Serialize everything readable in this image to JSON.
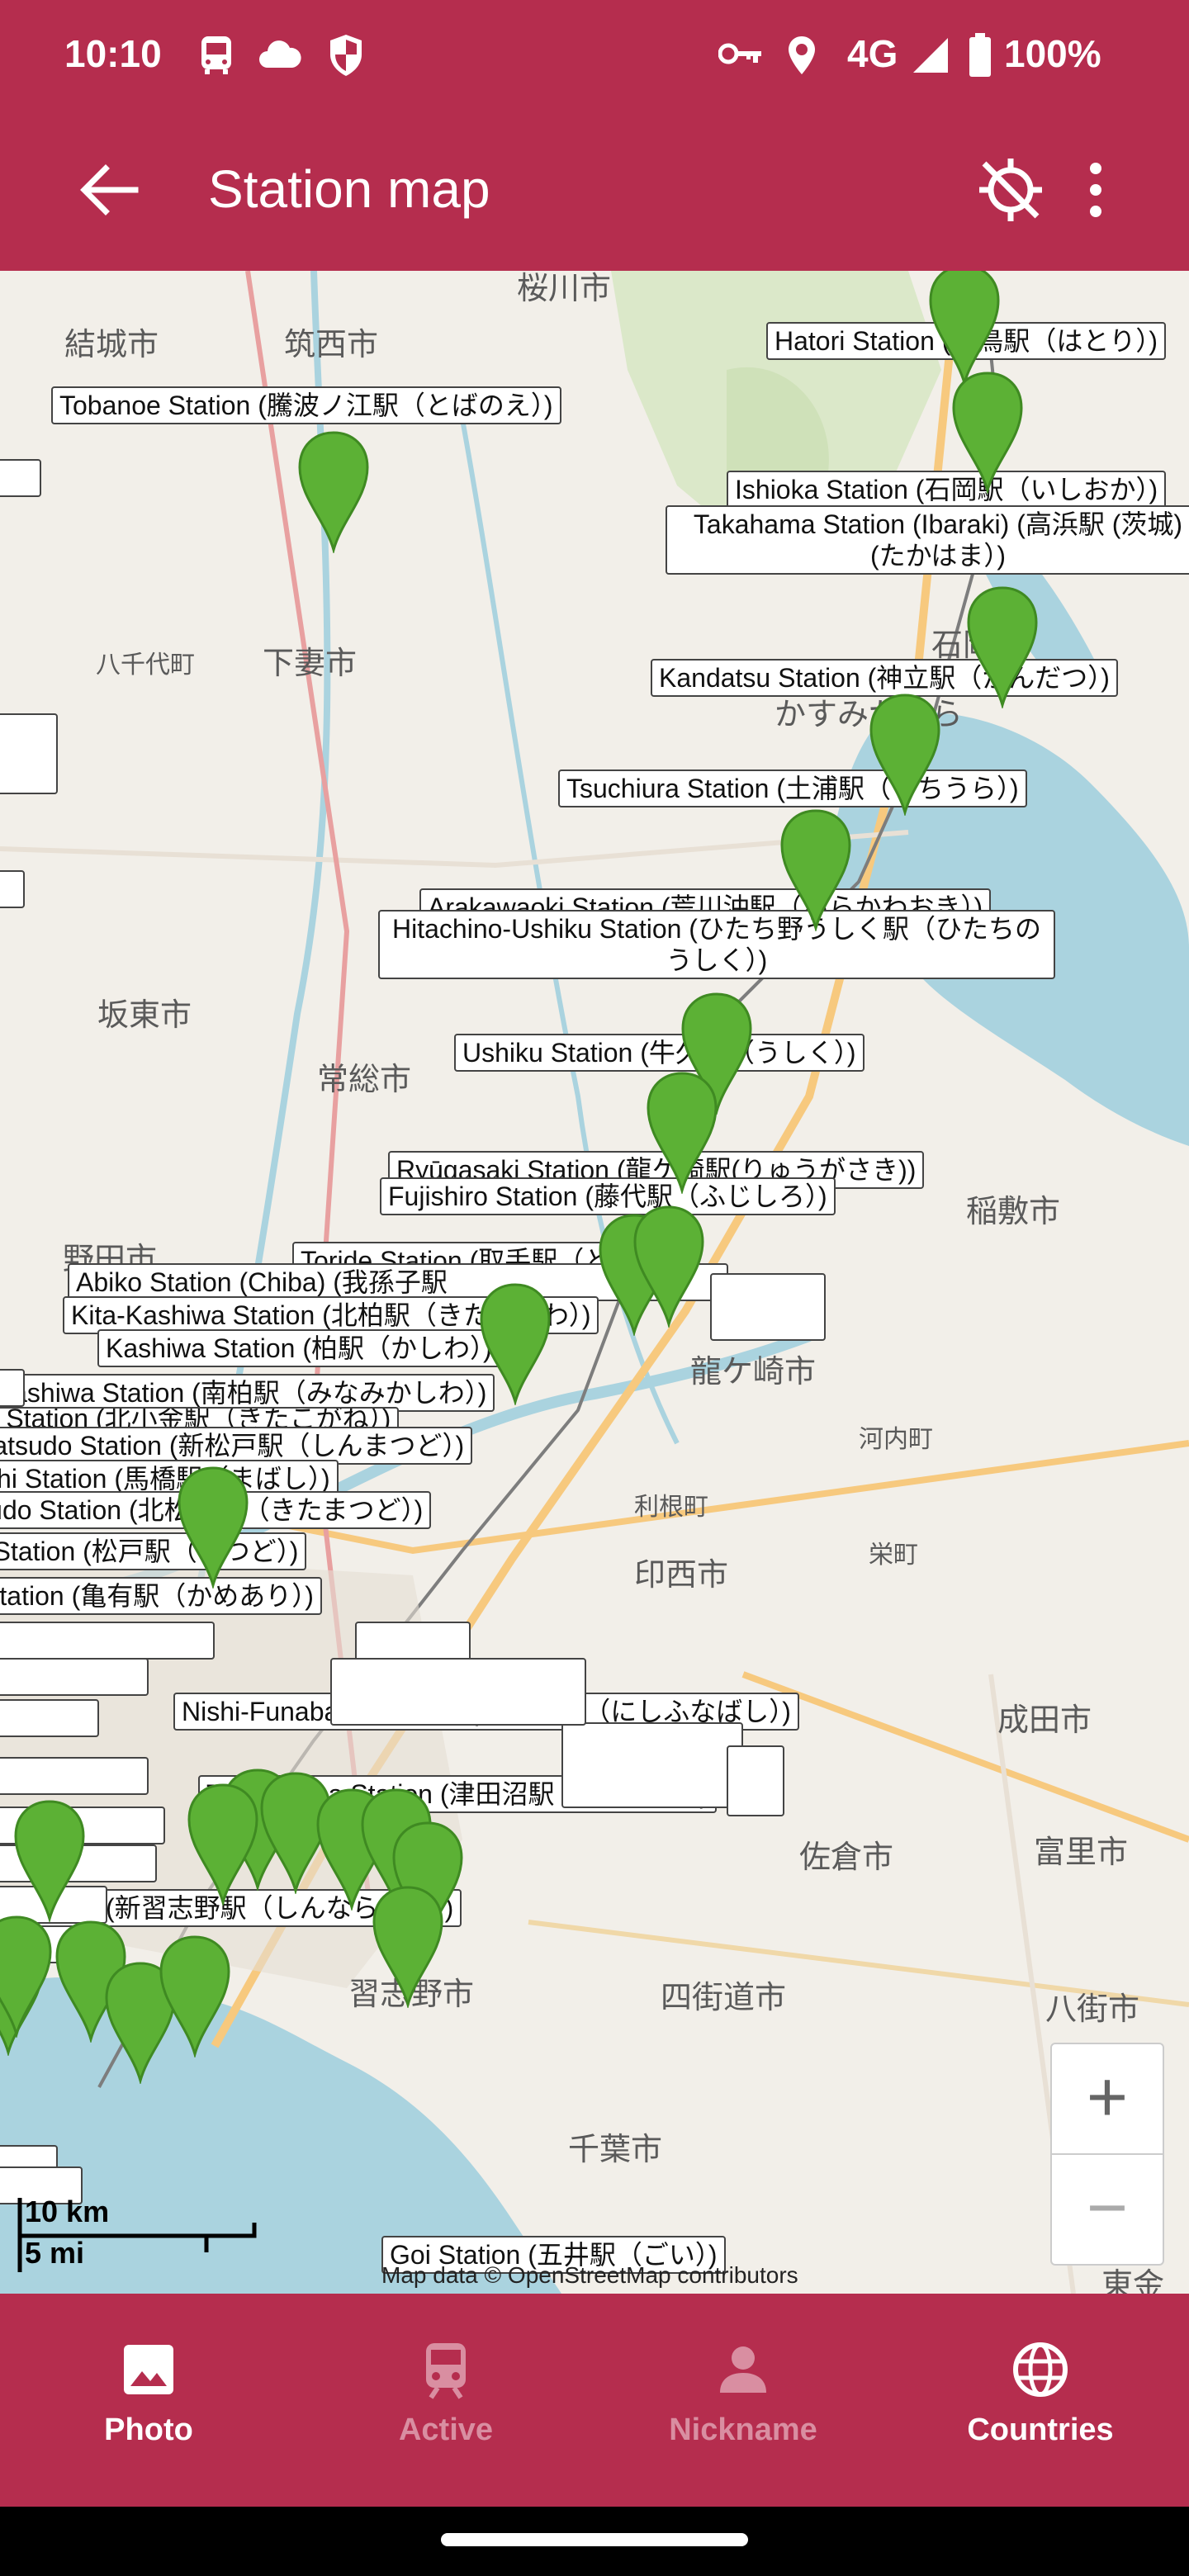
{
  "status": {
    "time": "10:10",
    "network": "4G",
    "battery": "100%"
  },
  "app": {
    "title": "Station map"
  },
  "colors": {
    "primary": "#b52d4e",
    "pin": "#5cb135",
    "inactive_tab": "#d98ea1"
  },
  "map": {
    "stations": [
      "Hatori Station (羽鳥駅（はとり）)",
      "Tobanoe Station (騰波ノ江駅（とばのえ）)",
      "Ishioka Station (石岡駅（いしおか）)",
      "Takahama Station (Ibaraki) (高浜駅 (茨城) (たかはま）)",
      "Kandatsu Station (神立駅（かんだつ）)",
      "Tsuchiura Station (土浦駅（つちうら）)",
      "Arakawaoki Station (荒川沖駅（あらかわおき）)",
      "Hitachino-Ushiku Station (ひたち野うしく駅（ひたちのうしく）)",
      "Ushiku Station (牛久駅（うしく）)",
      "Ryūgasaki Station (龍ケ崎駅(りゅうがさき))",
      "Fujishiro Station (藤代駅（ふじしろ）)",
      "Toride Station (取手駅（とりで）)",
      "Abiko Station (Chiba) (我孫子駅",
      "Kita-Kashiwa Station (北柏駅（きたかしわ）)",
      "Kashiwa Station (柏駅（かしわ）)",
      "Minami-Kashiwa Station (南柏駅（みなみかしわ）)",
      "Kaganc Station (北小金駅（きたこがね）)",
      "Shin-Matsudo Station (新松戸駅（しんまつど）)",
      "Mabashi Station (馬橋駅（まばし）)",
      "Kita-Matsudo Station (北松戸駅（きたまつど）)",
      "Matsudo Station (松戸駅（まつど）)",
      "Kameari Station (亀有駅（かめあり）)",
      "Nishi-Funabashi Station (西船橋駅（にしふなばし）)",
      "Tsudanuma Station (津田沼駅（つだぬま）)",
      "Shin-Narashino Station (新習志野駅（しんならしの）)",
      "Goi Station (五井駅（ごい）)"
    ],
    "places": [
      "桜川市",
      "結城市",
      "筑西市",
      "八千代町",
      "下妻市",
      "坂東市",
      "常総市",
      "野田市",
      "龍ケ崎市",
      "稲敷市",
      "河内町",
      "利根町",
      "印西市",
      "栄町",
      "成田市",
      "佐倉市",
      "富里市",
      "四街道市",
      "八街市",
      "習志野市",
      "千葉市",
      "東金市",
      "かすみがうら",
      "石岡"
    ],
    "scale": {
      "metric": "10 km",
      "imperial": "5 mi"
    },
    "attribution": "Map data © OpenStreetMap contributors",
    "zoom_in": "+",
    "zoom_out": "−"
  },
  "nav": [
    {
      "label": "Photo",
      "icon": "image-icon",
      "selected": true
    },
    {
      "label": "Active",
      "icon": "train-icon",
      "selected": false
    },
    {
      "label": "Nickname",
      "icon": "person-icon",
      "selected": false
    },
    {
      "label": "Countries",
      "icon": "globe-icon",
      "selected": true
    }
  ]
}
